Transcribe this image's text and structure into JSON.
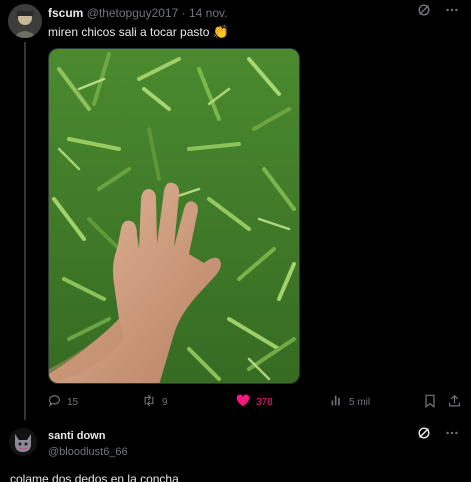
{
  "tweet": {
    "display_name": "fscum",
    "handle": "@thetopguy2017",
    "separator": "·",
    "date": "14 nov.",
    "text": "miren chicos sali a tocar pasto",
    "emoji": "👏",
    "stats": {
      "replies": "15",
      "retweets": "9",
      "likes": "378",
      "views": "5 mil"
    }
  },
  "reply": {
    "display_name": "santi down",
    "handle": "@bloodlust6_66",
    "text": "colame dos dedos en la concha"
  },
  "colors": {
    "background": "#000000",
    "text": "#e7e9ea",
    "muted": "#71767b",
    "like_active": "#f91880",
    "grass": "#3f7d2a"
  },
  "icons": {
    "grok": "grok-icon",
    "more": "more-icon",
    "reply": "reply-icon",
    "retweet": "retweet-icon",
    "like": "like-icon",
    "views": "views-icon",
    "bookmark": "bookmark-icon",
    "share": "share-icon"
  }
}
